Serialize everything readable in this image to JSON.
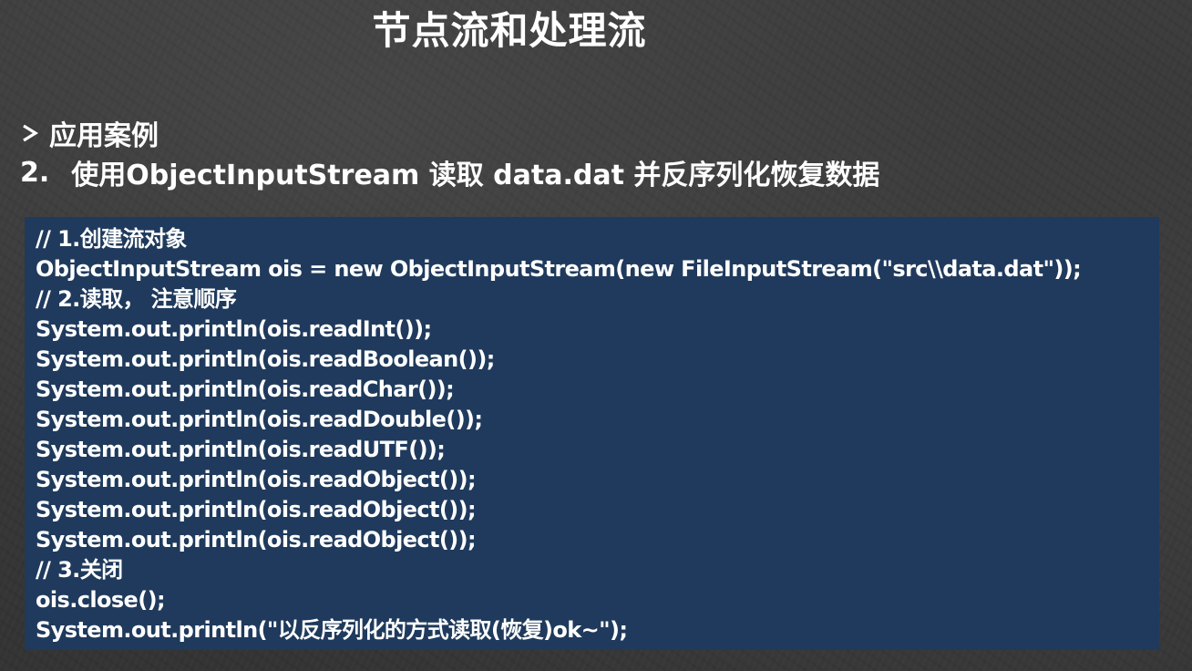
{
  "slide": {
    "title": "节点流和处理流",
    "section_label": "应用案例",
    "item_number": "2.",
    "item_text": "使用ObjectInputStream 读取 data.dat 并反序列化恢复数据"
  },
  "code": {
    "lines": [
      "// 1.创建流对象",
      "ObjectInputStream ois = new ObjectInputStream(new FileInputStream(\"src\\\\data.dat\"));",
      "// 2.读取， 注意顺序",
      "System.out.println(ois.readInt());",
      "System.out.println(ois.readBoolean());",
      "System.out.println(ois.readChar());",
      "System.out.println(ois.readDouble());",
      "System.out.println(ois.readUTF());",
      "System.out.println(ois.readObject());",
      "System.out.println(ois.readObject());",
      "System.out.println(ois.readObject());",
      "// 3.关闭",
      "ois.close();",
      "System.out.println(\"以反序列化的方式读取(恢复)ok~\");"
    ]
  },
  "icons": {
    "bullet": "arrow-bullet-icon"
  },
  "colors": {
    "code_background": "#1f3a5c",
    "text": "#ffffff",
    "background": "#3a3a3a"
  }
}
